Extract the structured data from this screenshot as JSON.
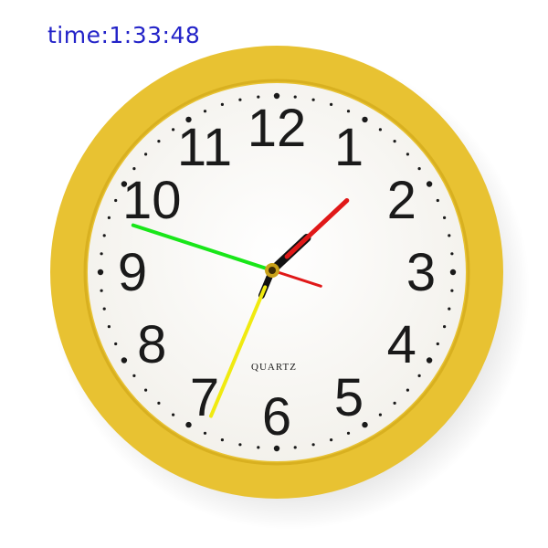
{
  "time_readout": "time:1:33:48",
  "clock": {
    "brand": "QUARTZ",
    "numerals": [
      "12",
      "1",
      "2",
      "3",
      "4",
      "5",
      "6",
      "7",
      "8",
      "9",
      "10",
      "11"
    ],
    "hands": {
      "hour": 1.563,
      "minute": 33.8,
      "second": 48
    }
  },
  "colors": {
    "readout_text": "#2323c8",
    "frame": "#e8c232",
    "frame_edge": "#d8b020",
    "face": "#fbfaf6",
    "marks": "#1a1a1a",
    "hour_hand": "#e01818",
    "minute_hand": "#f0ea10",
    "second_hand": "#19e619",
    "hand_base": "#111111",
    "pivot": "#c9a21a"
  }
}
